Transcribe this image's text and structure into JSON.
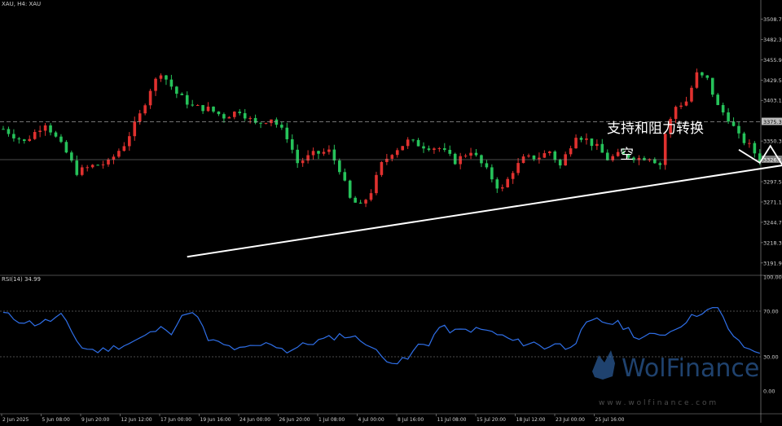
{
  "header": {
    "symbol_label": "XAU, H4:  XAU",
    "rsi_label": "RSI(14) 34.99"
  },
  "annotations": {
    "support_resistance_text": "支持和阻力转换",
    "short_text": "空"
  },
  "watermark": {
    "brand": "WolFinance",
    "url": "w w w . w o l f i n a n c e . c o m"
  },
  "colors": {
    "background": "#000000",
    "bull_candle": "#e0312f",
    "bear_candle": "#26c25a",
    "rsi_line": "#2f6fe8",
    "trendline": "#ffffff",
    "grid": "#9a9a9a",
    "axis_text": "#cfcfcf"
  },
  "chart_data": [
    {
      "type": "candlestick",
      "title": "XAU, H4:  XAU",
      "y_ticks": [
        3191.9,
        3218.3,
        3244.7,
        3271.1,
        3297.5,
        3350.3,
        3403.1,
        3429.5,
        3455.9,
        3482.3,
        3508.7
      ],
      "ylim": [
        3178,
        3525
      ],
      "current_price_label": "3326.10",
      "dashed_level_label": "3375.30",
      "dashed_level": 3375.3,
      "current_price": 3326.1,
      "x_tick_labels": [
        "2 Jun 2025",
        "5 Jun 08:00",
        "9 Jun 20:00",
        "12 Jun 12:00",
        "17 Jun 00:00",
        "19 Jun 16:00",
        "24 Jun 00:00",
        "26 Jun 20:00",
        "1 Jul 08:00",
        "4 Jul 00:00",
        "8 Jul 16:00",
        "11 Jul 08:00",
        "15 Jul 20:00",
        "18 Jul 12:00",
        "23 Jul 00:00",
        "25 Jul 16:00"
      ],
      "close_path": [
        [
          0,
          3366
        ],
        [
          4,
          3349
        ],
        [
          8,
          3374
        ],
        [
          12,
          3335
        ],
        [
          14,
          3310
        ],
        [
          17,
          3318
        ],
        [
          20,
          3322
        ],
        [
          23,
          3346
        ],
        [
          26,
          3384
        ],
        [
          28,
          3418
        ],
        [
          30,
          3440
        ],
        [
          33,
          3412
        ],
        [
          36,
          3395
        ],
        [
          39,
          3392
        ],
        [
          42,
          3382
        ],
        [
          45,
          3390
        ],
        [
          48,
          3372
        ],
        [
          51,
          3380
        ],
        [
          54,
          3356
        ],
        [
          56,
          3322
        ],
        [
          59,
          3333
        ],
        [
          62,
          3337
        ],
        [
          64,
          3314
        ],
        [
          66,
          3275
        ],
        [
          68,
          3265
        ],
        [
          70,
          3285
        ],
        [
          72,
          3320
        ],
        [
          74,
          3336
        ],
        [
          77,
          3350
        ],
        [
          80,
          3344
        ],
        [
          83,
          3341
        ],
        [
          86,
          3324
        ],
        [
          89,
          3338
        ],
        [
          92,
          3312
        ],
        [
          94,
          3292
        ],
        [
          95,
          3288
        ],
        [
          97,
          3312
        ],
        [
          99,
          3327
        ],
        [
          102,
          3330
        ],
        [
          104,
          3337
        ],
        [
          106,
          3318
        ],
        [
          109,
          3359
        ],
        [
          111,
          3352
        ],
        [
          113,
          3342
        ],
        [
          115,
          3327
        ],
        [
          117,
          3332
        ],
        [
          119,
          3331
        ],
        [
          121,
          3328
        ],
        [
          123,
          3330
        ],
        [
          125,
          3320
        ],
        [
          126,
          3360
        ],
        [
          128,
          3395
        ],
        [
          130,
          3402
        ],
        [
          132,
          3437
        ],
        [
          134,
          3430
        ],
        [
          136,
          3395
        ],
        [
          138,
          3380
        ],
        [
          140,
          3356
        ],
        [
          142,
          3344
        ],
        [
          144,
          3326
        ]
      ],
      "trendline": [
        [
          35,
          3200
        ],
        [
          223,
          3397
        ]
      ],
      "trendline_zigzag": [
        [
          140,
          3339
        ],
        [
          144,
          3322
        ],
        [
          146,
          3344
        ],
        [
          148,
          3322
        ],
        [
          153,
          3283
        ]
      ],
      "resistance_line_label": "3375.30"
    },
    {
      "type": "line",
      "title": "RSI(14) 34.99",
      "y_ticks": [
        0.0,
        30.0,
        70.0,
        100.0
      ],
      "ylim": [
        0,
        100
      ],
      "levels": [
        30,
        70
      ],
      "last_value": 34.99,
      "series": [
        {
          "values_path": [
            [
              0,
              68
            ],
            [
              3,
              62
            ],
            [
              6,
              59
            ],
            [
              9,
              62
            ],
            [
              11,
              66
            ],
            [
              13,
              52
            ],
            [
              15,
              38
            ],
            [
              18,
              35
            ],
            [
              21,
              38
            ],
            [
              24,
              42
            ],
            [
              27,
              48
            ],
            [
              29,
              53
            ],
            [
              31,
              56
            ],
            [
              32,
              52
            ],
            [
              35,
              70
            ],
            [
              37,
              64
            ],
            [
              39,
              45
            ],
            [
              42,
              40
            ],
            [
              45,
              36
            ],
            [
              48,
              39
            ],
            [
              51,
              42
            ],
            [
              54,
              35
            ],
            [
              57,
              40
            ],
            [
              60,
              44
            ],
            [
              62,
              46
            ],
            [
              64,
              49
            ],
            [
              66,
              48
            ],
            [
              69,
              43
            ],
            [
              72,
              30
            ],
            [
              75,
              25
            ],
            [
              77,
              28
            ],
            [
              79,
              40
            ],
            [
              81,
              42
            ],
            [
              83,
              56
            ],
            [
              86,
              52
            ],
            [
              89,
              54
            ],
            [
              92,
              53
            ],
            [
              95,
              48
            ],
            [
              97,
              44
            ],
            [
              99,
              42
            ],
            [
              101,
              42
            ],
            [
              103,
              38
            ],
            [
              105,
              42
            ],
            [
              107,
              38
            ],
            [
              109,
              44
            ],
            [
              111,
              58
            ],
            [
              113,
              62
            ],
            [
              115,
              60
            ],
            [
              117,
              59
            ],
            [
              119,
              54
            ],
            [
              121,
              46
            ],
            [
              123,
              48
            ],
            [
              125,
              50
            ],
            [
              127,
              52
            ],
            [
              130,
              62
            ],
            [
              133,
              70
            ],
            [
              136,
              72
            ],
            [
              138,
              55
            ],
            [
              140,
              42
            ],
            [
              142,
              36
            ],
            [
              144,
              35
            ]
          ]
        }
      ]
    }
  ]
}
